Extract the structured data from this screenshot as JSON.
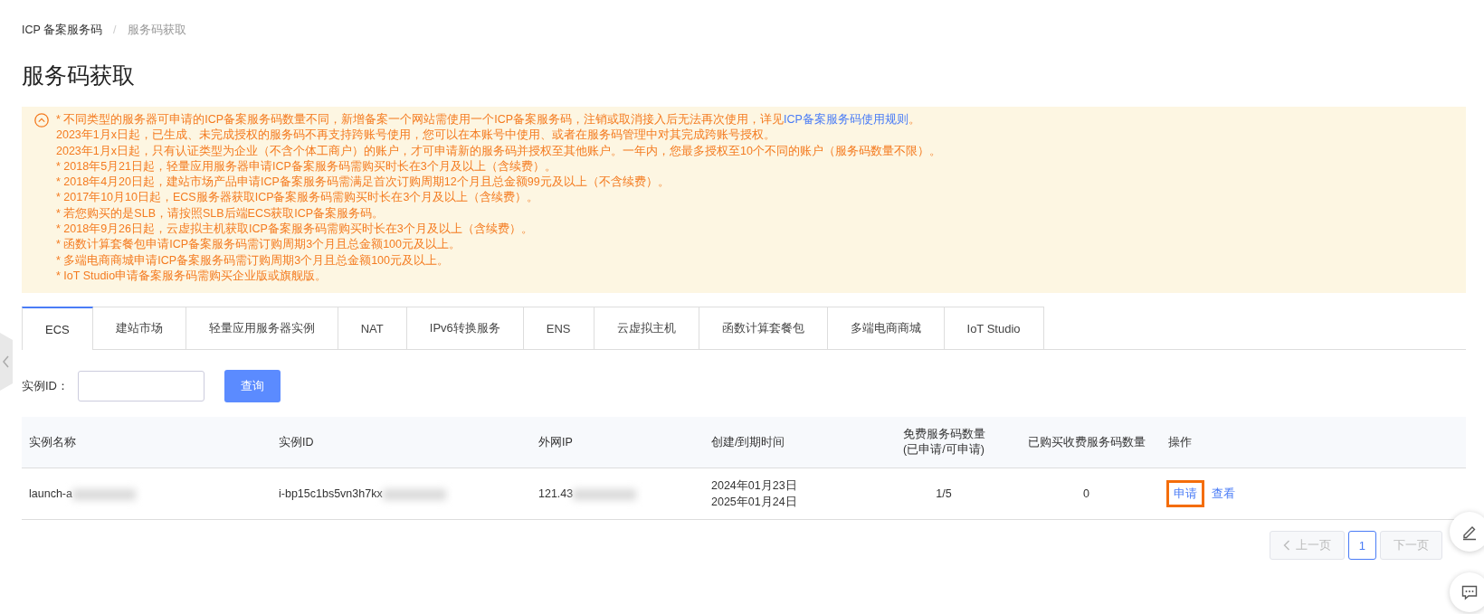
{
  "breadcrumb_separator": "/",
  "breadcrumb": [
    {
      "label": "ICP 备案服务码",
      "current": false
    },
    {
      "label": "服务码获取",
      "current": true
    }
  ],
  "title": "服务码获取",
  "notice": {
    "expanded": true,
    "lines": [
      {
        "text": "* 不同类型的服务器可申请的ICP备案服务码数量不同，新增备案一个网站需使用一个ICP备案服务码，注销或取消接入后无法再次使用，详见",
        "link": "ICP备案服务码使用规则",
        "tail": "。"
      },
      {
        "text": "2023年1月x日起，已生成、未完成授权的服务码不再支持跨账号使用，您可以在本账号中使用、或者在服务码管理中对其完成跨账号授权。"
      },
      {
        "text": "2023年1月x日起，只有认证类型为企业（不含个体工商户）的账户，才可申请新的服务码并授权至其他账户。一年内，您最多授权至10个不同的账户（服务码数量不限）。"
      },
      {
        "text": "* 2018年5月21日起，轻量应用服务器申请ICP备案服务码需购买时长在3个月及以上（含续费）。"
      },
      {
        "text": "* 2018年4月20日起，建站市场产品申请ICP备案服务码需满足首次订购周期12个月且总金额99元及以上（不含续费）。"
      },
      {
        "text": "* 2017年10月10日起，ECS服务器获取ICP备案服务码需购买时长在3个月及以上（含续费）。"
      },
      {
        "text": "* 若您购买的是SLB，请按照SLB后端ECS获取ICP备案服务码。"
      },
      {
        "text": "* 2018年9月26日起，云虚拟主机获取ICP备案服务码需购买时长在3个月及以上（含续费）。"
      },
      {
        "text": "* 函数计算套餐包申请ICP备案服务码需订购周期3个月且总金额100元及以上。"
      },
      {
        "text": "* 多端电商商城申请ICP备案服务码需订购周期3个月且总金额100元及以上。"
      },
      {
        "text": "* IoT Studio申请备案服务码需购买企业版或旗舰版。"
      }
    ]
  },
  "tabs": [
    {
      "label": "ECS",
      "selected": true
    },
    {
      "label": "建站市场",
      "selected": false
    },
    {
      "label": "轻量应用服务器实例",
      "selected": false
    },
    {
      "label": "NAT",
      "selected": false
    },
    {
      "label": "IPv6转换服务",
      "selected": false
    },
    {
      "label": "ENS",
      "selected": false
    },
    {
      "label": "云虚拟主机",
      "selected": false
    },
    {
      "label": "函数计算套餐包",
      "selected": false
    },
    {
      "label": "多端电商商城",
      "selected": false
    },
    {
      "label": "IoT Studio",
      "selected": false
    }
  ],
  "search": {
    "label": "实例ID：",
    "button": "查询"
  },
  "table": {
    "columns": [
      "实例名称",
      "实例ID",
      "外网IP",
      "创建/到期时间",
      "免费服务码数量\n(已申请/可申请)",
      "已购买收费服务码数量",
      "操作"
    ],
    "rows": [
      {
        "name": "launch-a",
        "id": "i-bp15c1bs5vn3h7kx",
        "ip": "121.43",
        "dates": [
          "2024年01月23日",
          "2025年01月24日"
        ],
        "free": "1/5",
        "paid": "0",
        "actions": [
          {
            "label": "申请",
            "highlighted": true
          },
          {
            "label": "查看",
            "highlighted": false
          }
        ]
      }
    ]
  },
  "pagination": {
    "prev": {
      "label": "上一页",
      "disabled": true
    },
    "pages": [
      {
        "label": "1",
        "selected": true
      }
    ],
    "next": {
      "label": "下一页",
      "disabled": true
    }
  }
}
